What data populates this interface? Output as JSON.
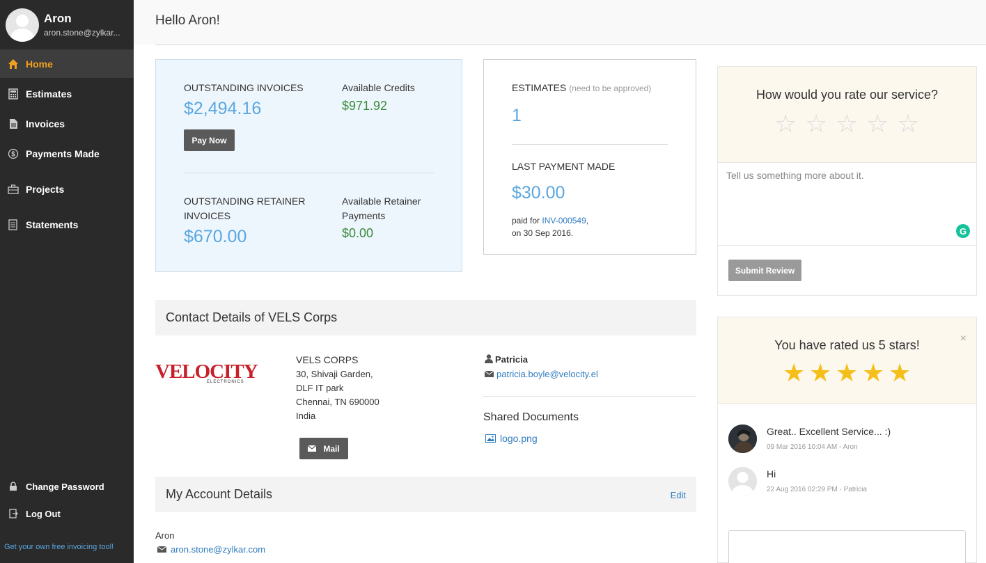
{
  "user": {
    "name": "Aron",
    "email": "aron.stone@zylkar..."
  },
  "nav": {
    "items": [
      {
        "label": "Home",
        "icon": "home-icon",
        "active": true
      },
      {
        "label": "Estimates",
        "icon": "calculator-icon"
      },
      {
        "label": "Invoices",
        "icon": "document-icon"
      },
      {
        "label": "Payments Made",
        "icon": "dollar-circle-icon"
      },
      {
        "label": "Projects",
        "icon": "briefcase-icon"
      },
      {
        "label": "Statements",
        "icon": "statement-icon"
      }
    ],
    "change_password": "Change Password",
    "log_out": "Log Out",
    "promo": "Get your own free invoicing tool!"
  },
  "header": {
    "greeting": "Hello Aron!"
  },
  "summary": {
    "outstanding_label": "OUTSTANDING INVOICES",
    "outstanding_amount": "$2,494.16",
    "credits_label": "Available Credits",
    "credits_amount": "$971.92",
    "pay_now": "Pay Now",
    "retainer_label_1": "OUTSTANDING RETAINER",
    "retainer_label_2": "INVOICES",
    "retainer_amount": "$670.00",
    "retainer_payments_label_1": "Available Retainer",
    "retainer_payments_label_2": "Payments",
    "retainer_payments_amount": "$0.00"
  },
  "estimates": {
    "label": "ESTIMATES",
    "sub": "(need to be approved)",
    "count": "1",
    "last_payment_label": "LAST PAYMENT MADE",
    "last_payment_amount": "$30.00",
    "paid_for_prefix": "paid for",
    "invoice_link": "INV-000549",
    "paid_for_suffix": ",",
    "date_line": "on 30 Sep 2016."
  },
  "contact": {
    "section_title": "Contact Details of VELS Corps",
    "logo_text": "VELOCITY",
    "logo_sub": "ELECTRONICS",
    "company": "VELS CORPS",
    "address": [
      "30, Shivaji Garden,",
      "DLF IT park",
      "Chennai, TN 690000",
      "India"
    ],
    "mail_button": "Mail",
    "person": "Patricia",
    "person_email": "patricia.boyle@velocity.el",
    "shared_title": "Shared Documents",
    "shared_file": "logo.png"
  },
  "account": {
    "section_title": "My Account Details",
    "edit": "Edit",
    "name": "Aron",
    "email": "aron.stone@zylkar.com"
  },
  "rating": {
    "question": "How would you rate our service?",
    "stars": 0,
    "placeholder": "Tell us something more about it.",
    "submit": "Submit Review"
  },
  "rated": {
    "title": "You have rated us 5 stars!",
    "stars": 5,
    "close": "×",
    "reviews": [
      {
        "text": "Great.. Excellent Service... :)",
        "meta": "09 Mar 2016 10:04 AM - Aron"
      },
      {
        "text": "Hi",
        "meta": "22 Aug 2016 02:29 PM - Patricia"
      }
    ]
  },
  "colors": {
    "accent": "#f0a020",
    "link": "#2e7bbf",
    "amount_blue": "#5aa7e0",
    "amount_green": "#3a8a3a",
    "star": "#f5bf1a",
    "sidebar": "#2a2a2a"
  }
}
